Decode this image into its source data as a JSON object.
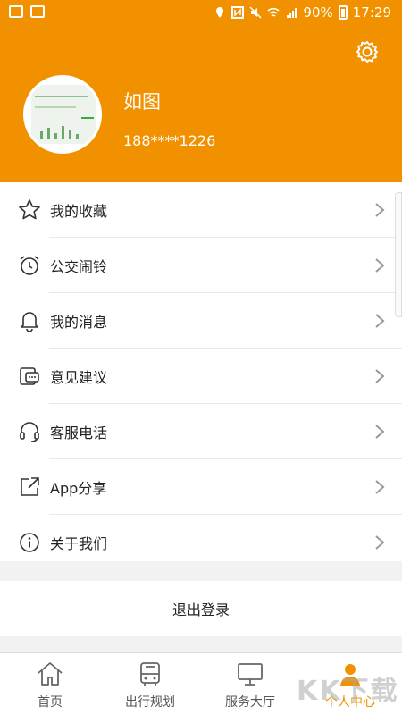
{
  "status_bar": {
    "battery": "90%",
    "time": "17:29"
  },
  "header": {
    "bg_color": "#f19100",
    "username": "如图",
    "phone": "188****1226"
  },
  "menu": {
    "items": [
      {
        "label": "我的收藏",
        "icon": "star-icon"
      },
      {
        "label": "公交闹铃",
        "icon": "alarm-clock-icon"
      },
      {
        "label": "我的消息",
        "icon": "bell-icon"
      },
      {
        "label": "意见建议",
        "icon": "feedback-icon"
      },
      {
        "label": "客服电话",
        "icon": "headset-icon"
      },
      {
        "label": "App分享",
        "icon": "share-icon"
      },
      {
        "label": "关于我们",
        "icon": "info-icon"
      }
    ]
  },
  "logout": {
    "label": "退出登录"
  },
  "tabbar": {
    "active_color": "#f19100",
    "tabs": [
      {
        "label": "首页",
        "icon": "home-icon"
      },
      {
        "label": "出行规划",
        "icon": "bus-icon"
      },
      {
        "label": "服务大厅",
        "icon": "monitor-icon"
      },
      {
        "label": "个人中心",
        "icon": "person-icon",
        "active": true
      }
    ]
  },
  "watermark": "KK下载"
}
